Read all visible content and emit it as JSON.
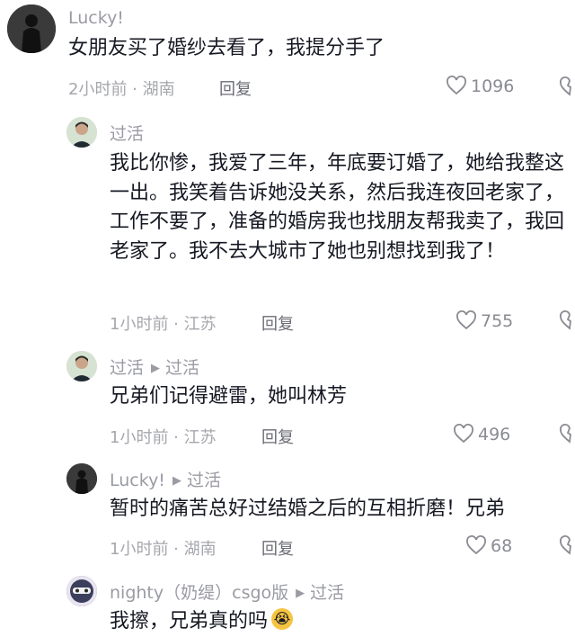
{
  "comments": [
    {
      "username": "Lucky!",
      "reply_to": "",
      "text": "女朋友买了婚纱去看了，我提分手了",
      "time_location": "2小时前 · 湖南",
      "reply_label": "回复",
      "likes": "1096"
    },
    {
      "username": "过活",
      "reply_to": "",
      "text": "我比你惨，我爱了三年，年底要订婚了，她给我整这一出。我笑着告诉她没关系，然后我连夜回老家了，工作不要了，准备的婚房我也找朋友帮我卖了，我回老家了。我不去大城市了她也别想找到我了！",
      "time_location": "1小时前 · 江苏",
      "reply_label": "回复",
      "likes": "755"
    },
    {
      "username": "过活",
      "reply_to": "过活",
      "text": "兄弟们记得避雷，她叫林芳",
      "time_location": "1小时前 · 江苏",
      "reply_label": "回复",
      "likes": "496"
    },
    {
      "username": "Lucky!",
      "reply_to": "过活",
      "text": "暂时的痛苦总好过结婚之后的互相折磨！兄弟",
      "time_location": "1小时前 · 湖南",
      "reply_label": "回复",
      "likes": "68"
    },
    {
      "username": "nighty（奶缇）csgo版",
      "reply_to": "过活",
      "text": "我擦，兄弟真的吗",
      "emoji": "😭",
      "time_location": "",
      "reply_label": "",
      "likes": ""
    }
  ],
  "icons": {
    "like": "heart-outline-icon",
    "dislike": "heart-broken-outline-icon",
    "reply_arrow": "triangle-right-icon"
  },
  "colors": {
    "text": "#161823",
    "username": "#9a9ba3",
    "meta": "#a6a7ad",
    "emoji_bg": "#f5c542"
  }
}
